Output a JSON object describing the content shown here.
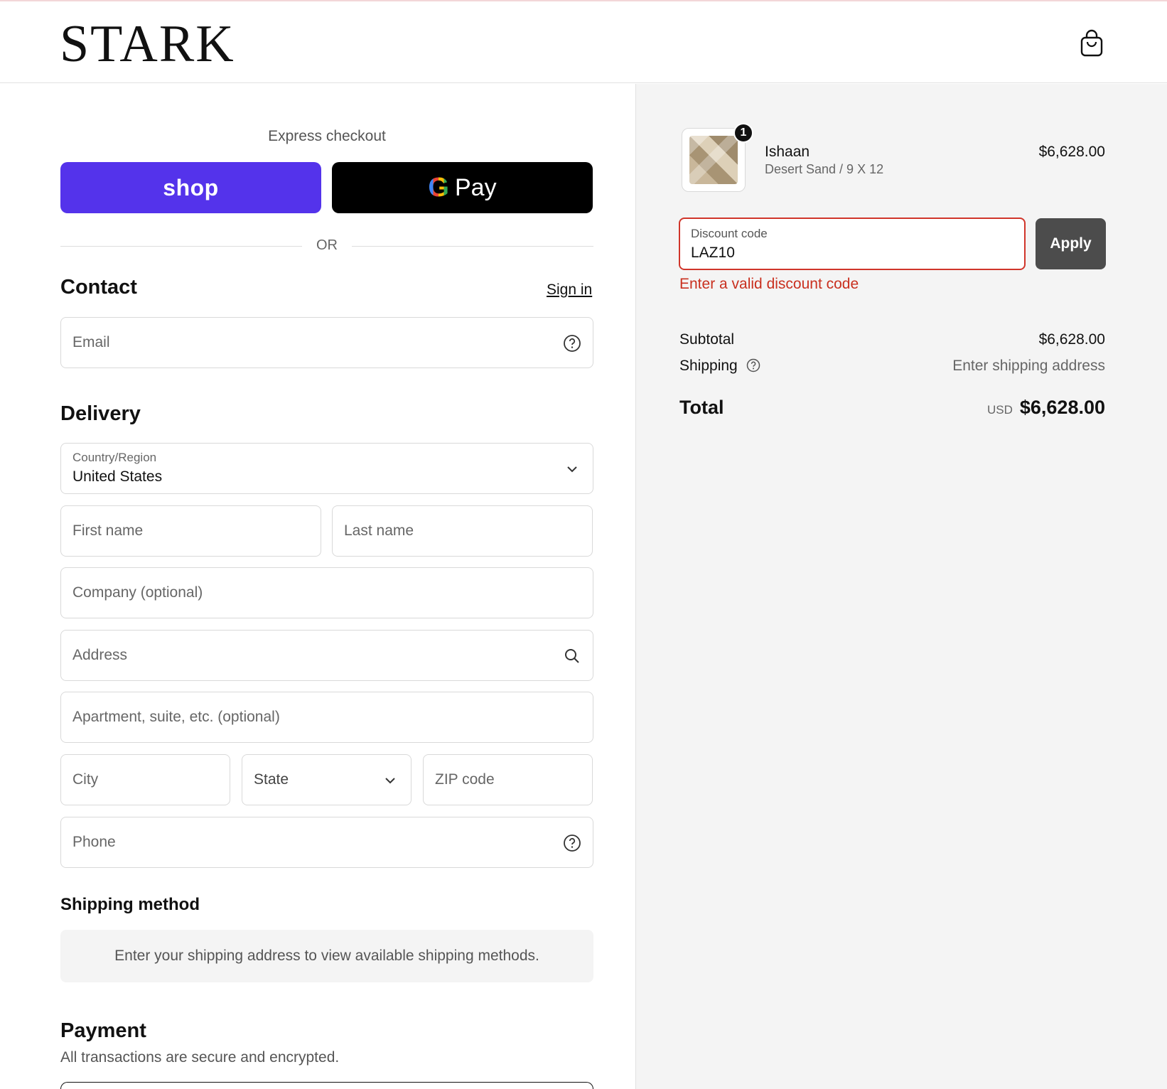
{
  "header": {
    "logo": "STARK",
    "cart_icon": "shopping-bag-icon"
  },
  "express": {
    "label": "Express checkout",
    "shop_label": "shop",
    "gpay_g": "G",
    "gpay_label": "Pay",
    "divider": "OR"
  },
  "contact": {
    "title": "Contact",
    "signin": "Sign in",
    "email_placeholder": "Email"
  },
  "delivery": {
    "title": "Delivery",
    "country_label": "Country/Region",
    "country_value": "United States",
    "first_name": "First name",
    "last_name": "Last name",
    "company": "Company (optional)",
    "address": "Address",
    "apartment": "Apartment, suite, etc. (optional)",
    "city": "City",
    "state": "State",
    "zip": "ZIP code",
    "phone": "Phone"
  },
  "shipping_method": {
    "title": "Shipping method",
    "info": "Enter your shipping address to view available shipping methods."
  },
  "payment": {
    "title": "Payment",
    "subtitle": "All transactions are secure and encrypted."
  },
  "order": {
    "quantity": "1",
    "product_name": "Ishaan",
    "variant": "Desert Sand / 9 X 12",
    "price": "$6,628.00"
  },
  "discount": {
    "label": "Discount code",
    "value": "LAZ10",
    "apply": "Apply",
    "error": "Enter a valid discount code"
  },
  "summary": {
    "subtotal_label": "Subtotal",
    "subtotal_value": "$6,628.00",
    "shipping_label": "Shipping",
    "shipping_value": "Enter shipping address",
    "total_label": "Total",
    "currency": "USD",
    "total_value": "$6,628.00"
  },
  "colors": {
    "shop_purple": "#5433eb",
    "error_red": "#d0352a",
    "apply_gray": "#4c4c4c"
  }
}
